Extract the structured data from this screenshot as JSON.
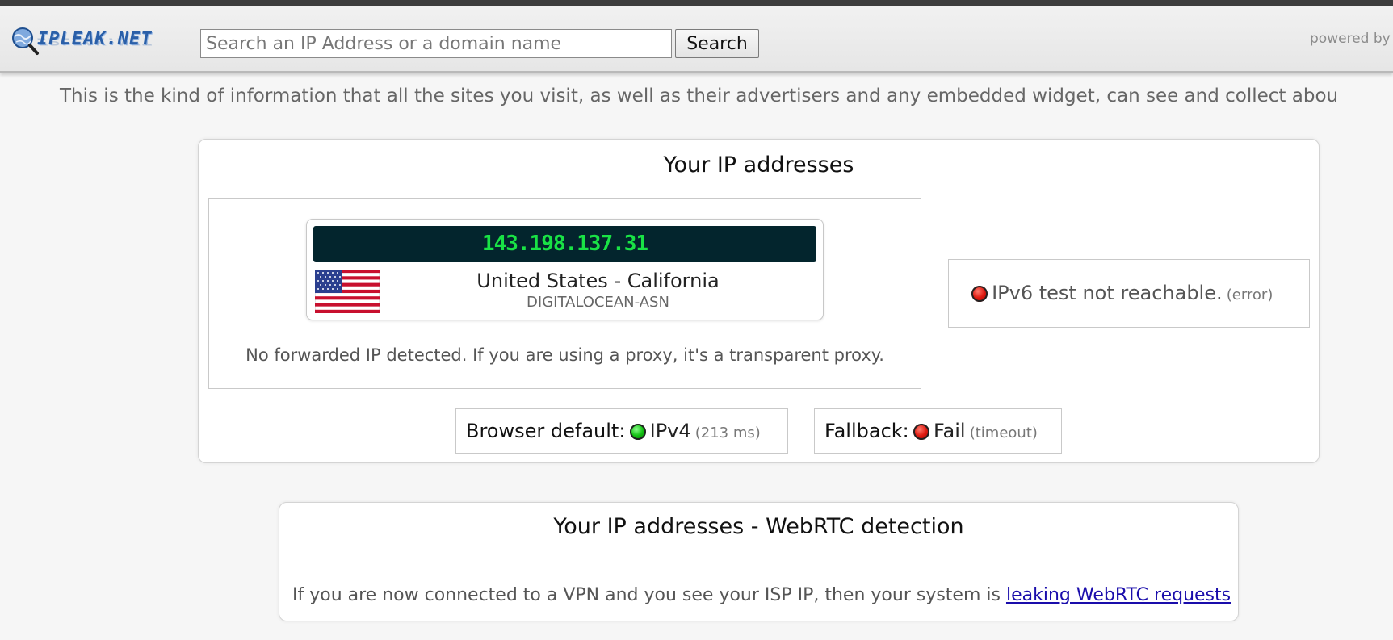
{
  "header": {
    "logo_text": "IPLEAK.NET",
    "search": {
      "placeholder": "Search an IP Address or a domain name",
      "value": ""
    },
    "search_button_label": "Search",
    "powered_by": "powered by"
  },
  "intro_text": "This is the kind of information that all the sites you visit, as well as their advertisers and any embedded widget, can see and collect abou",
  "ip_panel": {
    "title": "Your IP addresses",
    "ip": "143.198.137.31",
    "location": "United States - California",
    "asn": "DIGITALOCEAN-ASN",
    "forwarded_note": "No forwarded IP detected. If you are using a proxy, it's a transparent proxy.",
    "ipv6": {
      "message": "IPv6 test not reachable.",
      "detail": "(error)",
      "status_color": "#e01a10"
    },
    "browser_default": {
      "label": "Browser default:",
      "value": "IPv4",
      "detail": "(213 ms)",
      "status_color": "#12c212"
    },
    "fallback": {
      "label": "Fallback:",
      "value": "Fail",
      "detail": "(timeout)",
      "status_color": "#e01a10"
    }
  },
  "webrtc_panel": {
    "title": "Your IP addresses - WebRTC detection",
    "note": "If you are now connected to a VPN and you see your ISP IP, then your system is",
    "link_text": "leaking WebRTC requests"
  },
  "icons": [
    "globe-magnifier-icon",
    "us-flag-icon",
    "status-dot-icon"
  ]
}
